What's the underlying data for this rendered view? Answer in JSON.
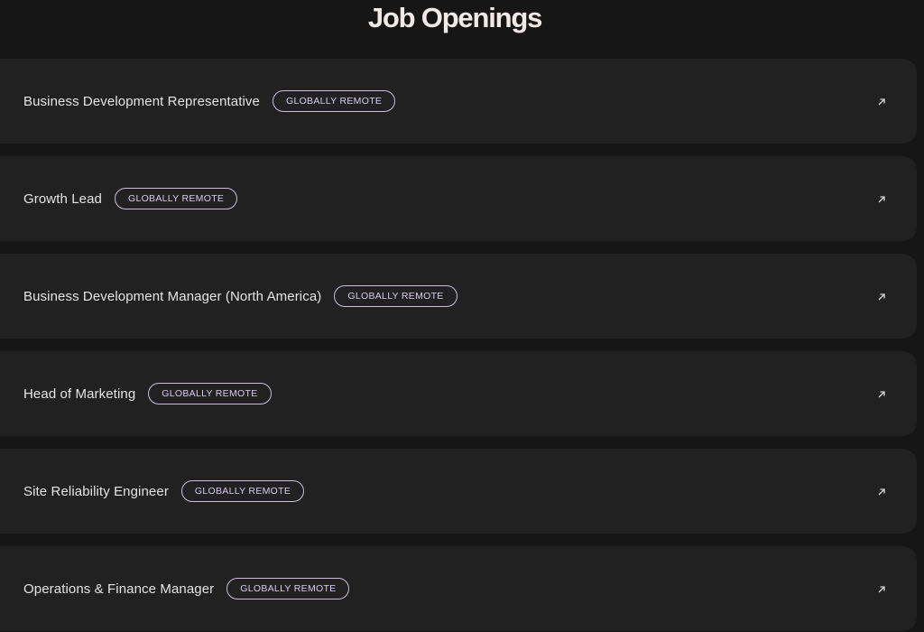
{
  "page": {
    "title": "Job Openings"
  },
  "jobs": [
    {
      "title": "Business Development Representative",
      "badge": "GLOBALLY REMOTE"
    },
    {
      "title": "Growth Lead",
      "badge": "GLOBALLY REMOTE"
    },
    {
      "title": "Business Development Manager (North America)",
      "badge": "GLOBALLY REMOTE"
    },
    {
      "title": "Head of Marketing",
      "badge": "GLOBALLY REMOTE"
    },
    {
      "title": "Site Reliability Engineer",
      "badge": "GLOBALLY REMOTE"
    },
    {
      "title": "Operations & Finance Manager",
      "badge": "GLOBALLY REMOTE"
    }
  ],
  "icons": {
    "open_link": "arrow-up-right-icon"
  },
  "colors": {
    "background": "#161616",
    "card": "#212121",
    "title": "#f1e9e6",
    "badge_border": "#cbbde2"
  }
}
